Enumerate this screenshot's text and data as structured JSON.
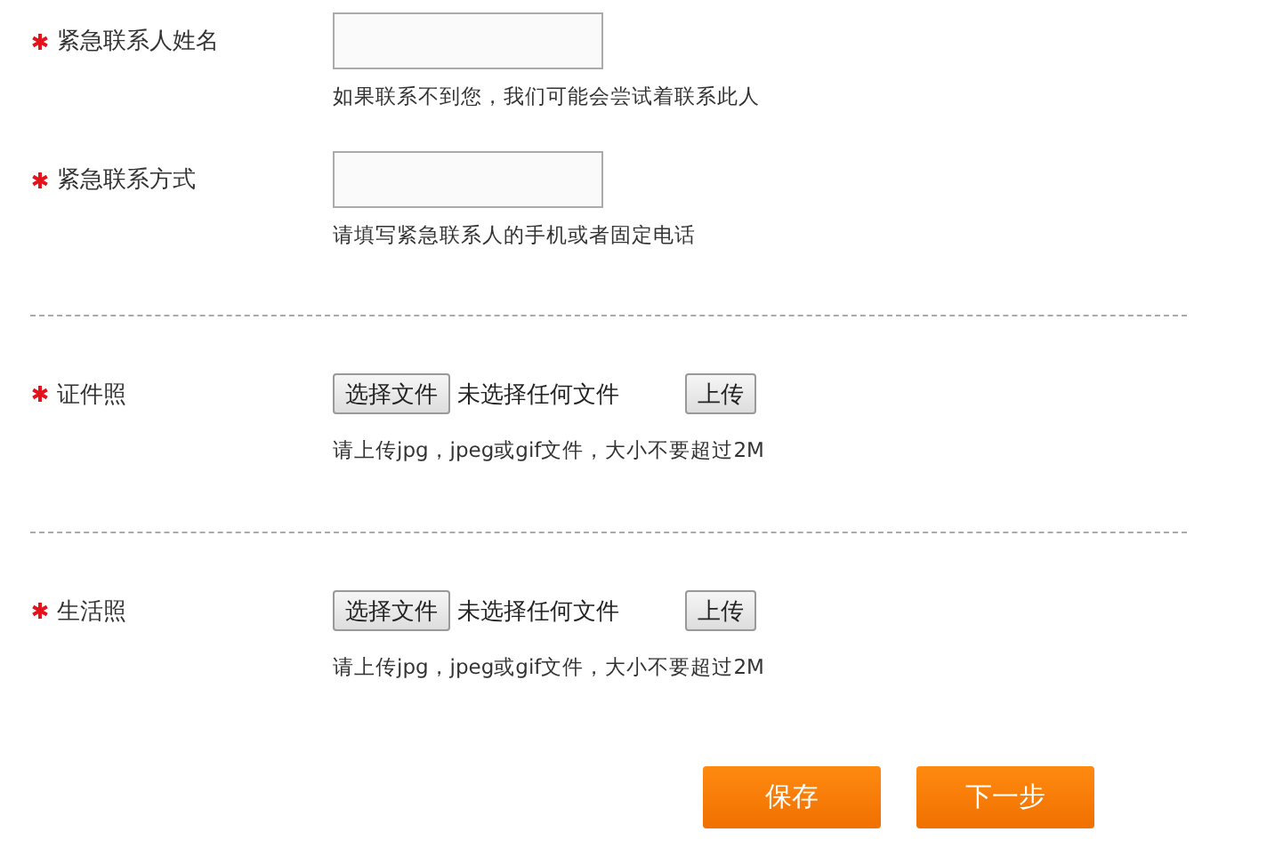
{
  "sections": [
    {
      "fields": [
        {
          "kind": "text",
          "required": true,
          "label": "紧急联系人姓名",
          "hint": "如果联系不到您，我们可能会尝试着联系此人"
        },
        {
          "kind": "text",
          "required": true,
          "label": "紧急联系方式",
          "hint": "请填写紧急联系人的手机或者固定电话"
        }
      ]
    },
    {
      "fields": [
        {
          "kind": "file",
          "required": true,
          "label": "证件照",
          "choose": "选择文件",
          "status": "未选择任何文件",
          "upload": "上传",
          "hint": "请上传jpg，jpeg或gif文件，大小不要超过2M"
        }
      ]
    },
    {
      "fields": [
        {
          "kind": "file",
          "required": true,
          "label": "生活照",
          "choose": "选择文件",
          "status": "未选择任何文件",
          "upload": "上传",
          "hint": "请上传jpg，jpeg或gif文件，大小不要超过2M"
        }
      ]
    }
  ],
  "buttons": [
    "保存",
    "下一步"
  ]
}
